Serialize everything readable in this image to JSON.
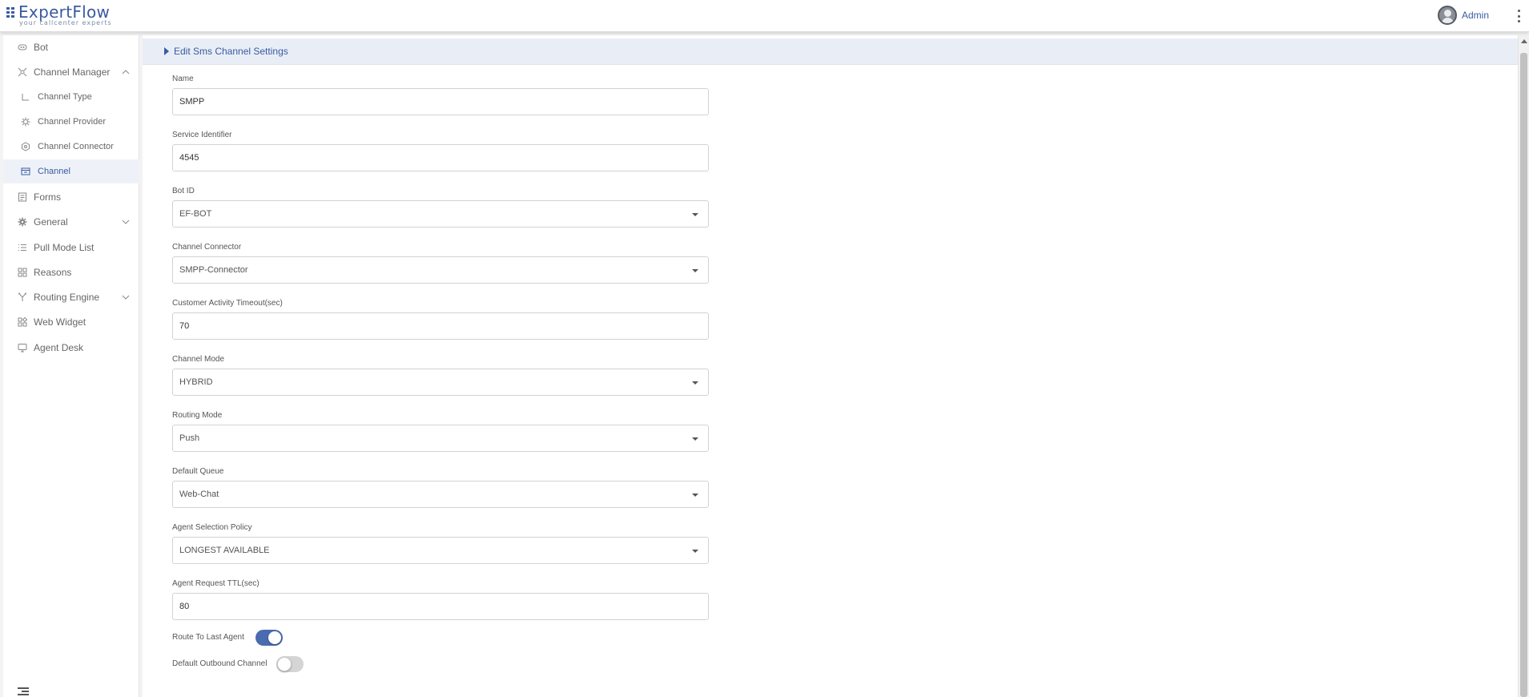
{
  "header": {
    "logo_text": "ExpertFlow",
    "logo_tagline": "your callcenter experts",
    "user_name": "Admin",
    "avatar_icon": "user-avatar-icon",
    "menu_icon": "kebab-menu-icon"
  },
  "sidebar": {
    "items": [
      {
        "label": "Bot",
        "icon": "bot-icon"
      },
      {
        "label": "Channel Manager",
        "icon": "channel-manager-icon",
        "expanded": true
      },
      {
        "label": "Channel Type",
        "icon": "channel-type-icon",
        "sub": true
      },
      {
        "label": "Channel Provider",
        "icon": "channel-provider-icon",
        "sub": true
      },
      {
        "label": "Channel Connector",
        "icon": "channel-connector-icon",
        "sub": true
      },
      {
        "label": "Channel",
        "icon": "channel-icon",
        "sub": true,
        "active": true
      },
      {
        "label": "Forms",
        "icon": "forms-icon"
      },
      {
        "label": "General",
        "icon": "gear-icon",
        "expanded": false
      },
      {
        "label": "Pull Mode List",
        "icon": "list-icon"
      },
      {
        "label": "Reasons",
        "icon": "grid-icon"
      },
      {
        "label": "Routing Engine",
        "icon": "routing-icon",
        "expanded": false
      },
      {
        "label": "Web Widget",
        "icon": "widget-icon"
      },
      {
        "label": "Agent Desk",
        "icon": "monitor-icon"
      }
    ],
    "collapse_icon": "collapse-menu-icon"
  },
  "panel": {
    "title": "Edit Sms Channel Settings"
  },
  "form": {
    "name": {
      "label": "Name",
      "value": "SMPP"
    },
    "service_identifier": {
      "label": "Service Identifier",
      "value": "4545"
    },
    "bot_id": {
      "label": "Bot ID",
      "value": "EF-BOT"
    },
    "channel_connector": {
      "label": "Channel Connector",
      "value": "SMPP-Connector"
    },
    "customer_activity_timeout": {
      "label": "Customer Activity Timeout(sec)",
      "value": "70"
    },
    "channel_mode": {
      "label": "Channel Mode",
      "value": "HYBRID"
    },
    "routing_mode": {
      "label": "Routing Mode",
      "value": "Push"
    },
    "default_queue": {
      "label": "Default Queue",
      "value": "Web-Chat"
    },
    "agent_selection_policy": {
      "label": "Agent Selection Policy",
      "value": "LONGEST AVAILABLE"
    },
    "agent_request_ttl": {
      "label": "Agent Request TTL(sec)",
      "value": "80"
    },
    "route_to_last_agent": {
      "label": "Route To Last Agent",
      "on": true
    },
    "default_outbound_channel": {
      "label": "Default Outbound Channel",
      "on": false
    }
  },
  "colors": {
    "accent": "#3a5aa0",
    "toggle_on": "#4a6bb0",
    "panel_header_bg": "#e9eef6"
  }
}
